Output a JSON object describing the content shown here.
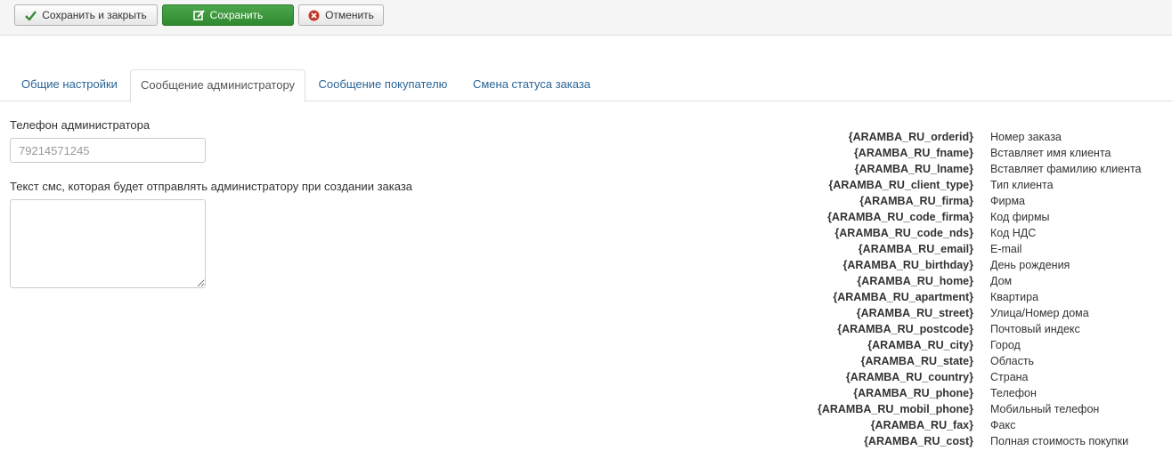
{
  "toolbar": {
    "save_close_label": "Сохранить и закрыть",
    "save_label": "Сохранить",
    "cancel_label": "Отменить",
    "save_color": "#3c9a3c"
  },
  "tabs": [
    {
      "label": "Общие настройки",
      "active": false
    },
    {
      "label": "Сообщение администратору",
      "active": true
    },
    {
      "label": "Сообщение покупателю",
      "active": false
    },
    {
      "label": "Смена статуса заказа",
      "active": false
    }
  ],
  "form": {
    "phone_label": "Телефон администратора",
    "phone_value": "",
    "phone_placeholder": "79214571245",
    "sms_label": "Текст смс, которая будет отправлять администратору при создании заказа",
    "sms_value": ""
  },
  "variables": [
    {
      "code": "{ARAMBA_RU_orderid}",
      "desc": "Номер заказа"
    },
    {
      "code": "{ARAMBA_RU_fname}",
      "desc": "Вставляет имя клиента"
    },
    {
      "code": "{ARAMBA_RU_lname}",
      "desc": "Вставляет фамилию клиента"
    },
    {
      "code": "{ARAMBA_RU_client_type}",
      "desc": "Тип клиента"
    },
    {
      "code": "{ARAMBA_RU_firma}",
      "desc": "Фирма"
    },
    {
      "code": "{ARAMBA_RU_code_firma}",
      "desc": "Код фирмы"
    },
    {
      "code": "{ARAMBA_RU_code_nds}",
      "desc": "Код НДС"
    },
    {
      "code": "{ARAMBA_RU_email}",
      "desc": "E-mail"
    },
    {
      "code": "{ARAMBA_RU_birthday}",
      "desc": "День рождения"
    },
    {
      "code": "{ARAMBA_RU_home}",
      "desc": "Дом"
    },
    {
      "code": "{ARAMBA_RU_apartment}",
      "desc": "Квартира"
    },
    {
      "code": "{ARAMBA_RU_street}",
      "desc": "Улица/Номер дома"
    },
    {
      "code": "{ARAMBA_RU_postcode}",
      "desc": "Почтовый индекс"
    },
    {
      "code": "{ARAMBA_RU_city}",
      "desc": "Город"
    },
    {
      "code": "{ARAMBA_RU_state}",
      "desc": "Область"
    },
    {
      "code": "{ARAMBA_RU_country}",
      "desc": "Страна"
    },
    {
      "code": "{ARAMBA_RU_phone}",
      "desc": "Телефон"
    },
    {
      "code": "{ARAMBA_RU_mobil_phone}",
      "desc": "Мобильный телефон"
    },
    {
      "code": "{ARAMBA_RU_fax}",
      "desc": "Факс"
    },
    {
      "code": "{ARAMBA_RU_cost}",
      "desc": "Полная стоимость покупки"
    }
  ]
}
